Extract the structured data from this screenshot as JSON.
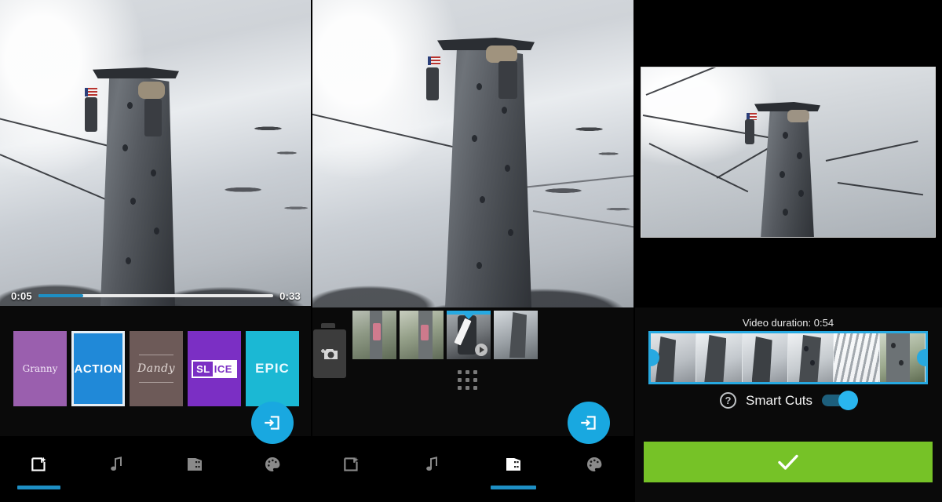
{
  "app": {
    "name": "video-editor",
    "accent": "#19a8e0",
    "confirm_color": "#76c227",
    "selected_outline": "#e6eef4"
  },
  "panel_themes": {
    "name": "themes-panel",
    "scrubber": {
      "current_time": "0:05",
      "total_time": "0:33",
      "progress_percent": 19
    },
    "themes": [
      {
        "id": "granny",
        "label": "Granny",
        "color": "#9a5fae",
        "selected": false
      },
      {
        "id": "action",
        "label": "ACTION",
        "color": "#2089d8",
        "selected": true
      },
      {
        "id": "dandy",
        "label": "Dandy",
        "color": "#6d5a58",
        "selected": false
      },
      {
        "id": "slice",
        "label": "SLICE",
        "label_part1": "SL",
        "label_part2": "ICE",
        "color": "#7b2fc4",
        "selected": false
      },
      {
        "id": "epic",
        "label": "EPIC",
        "color": "#1bb8d4",
        "selected": false
      }
    ],
    "fab": {
      "icon": "export-icon"
    },
    "nav": [
      {
        "id": "effects",
        "icon": "magic-photo-icon",
        "active": true
      },
      {
        "id": "music",
        "icon": "music-note-icon",
        "active": false
      },
      {
        "id": "clips",
        "icon": "film-clip-icon",
        "active": false
      },
      {
        "id": "themes",
        "icon": "palette-icon",
        "active": false
      }
    ]
  },
  "panel_clips": {
    "name": "clips-panel",
    "add_clip": {
      "icon": "add-camera-icon"
    },
    "clips": [
      {
        "id": "clip-1",
        "selected": false,
        "has_play": false
      },
      {
        "id": "clip-2",
        "selected": false,
        "has_play": false
      },
      {
        "id": "clip-3",
        "selected": true,
        "has_play": true
      },
      {
        "id": "clip-4",
        "selected": false,
        "has_play": false
      }
    ],
    "drag_handle": {
      "icon": "drag-dots-icon"
    },
    "fab": {
      "icon": "export-icon"
    },
    "nav": [
      {
        "id": "effects",
        "icon": "magic-photo-icon",
        "active": false
      },
      {
        "id": "music",
        "icon": "music-note-icon",
        "active": false
      },
      {
        "id": "clips",
        "icon": "film-clip-icon",
        "active": true
      },
      {
        "id": "themes",
        "icon": "palette-icon",
        "active": false
      }
    ]
  },
  "panel_trim": {
    "name": "trim-panel",
    "video_duration_label": "Video duration: 0:54",
    "filmstrip": {
      "frames": 6,
      "border_color": "#27a9e1",
      "handle_left": "trim-handle-left",
      "handle_right": "trim-handle-right"
    },
    "smart_cuts": {
      "help_icon": "help-circle-icon",
      "label": "Smart Cuts",
      "enabled": true
    },
    "confirm": {
      "icon": "checkmark-icon",
      "color": "#76c227"
    }
  }
}
